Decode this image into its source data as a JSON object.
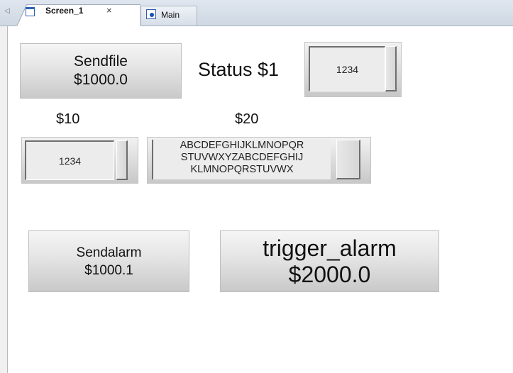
{
  "tabs": [
    {
      "label": "Screen_1",
      "close": "×",
      "icon": "window-icon",
      "active": true
    },
    {
      "label": "Main",
      "icon": "main-screen-icon",
      "active": false
    }
  ],
  "scroll_left_glyph": "◁",
  "canvas": {
    "send_file_button": {
      "line1": "Sendfile",
      "line2": "$1000.0"
    },
    "status_label": "Status $1",
    "status_io": {
      "value": "1234"
    },
    "label_10": "$10",
    "label_20": "$20",
    "io_10": {
      "value": "1234"
    },
    "io_20": {
      "lines": [
        "ABCDEFGHIJKLMNOPQR",
        "STUVWXYZABCDEFGHIJ",
        "KLMNOPQRSTUVWX"
      ]
    },
    "send_alarm_button": {
      "line1": "Sendalarm",
      "line2": "$1000.1"
    },
    "trigger_alarm_button": {
      "line1": "trigger_alarm",
      "line2": "$2000.0"
    }
  },
  "colors": {
    "tab_strip": "#cfd8e3",
    "canvas": "#ffffff",
    "button_face": "#e4e4e4"
  }
}
